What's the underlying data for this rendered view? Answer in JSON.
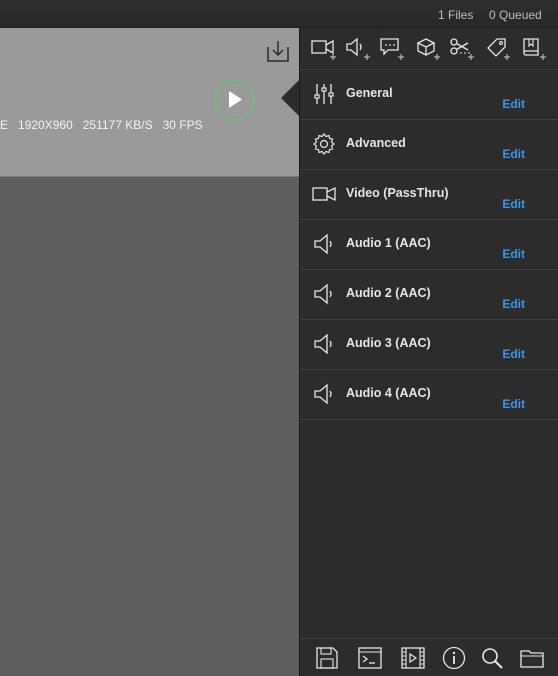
{
  "status": {
    "files": "1 Files",
    "queued": "0 Queued"
  },
  "file_item": {
    "info": [
      "E",
      "1920X960",
      "251177 KB/S",
      "30 FPS"
    ]
  },
  "toolbar": {
    "icons": [
      "add-video-icon",
      "add-audio-icon",
      "add-subtitle-icon",
      "add-package-icon",
      "add-trim-icon",
      "add-tag-icon",
      "add-chapter-icon"
    ]
  },
  "settings": {
    "items": [
      {
        "label": "General",
        "icon": "sliders-icon",
        "edit": "Edit"
      },
      {
        "label": "Advanced",
        "icon": "gear-icon",
        "edit": "Edit"
      },
      {
        "label": "Video (PassThru)",
        "icon": "video-camera-icon",
        "edit": "Edit"
      },
      {
        "label": "Audio 1 (AAC)",
        "icon": "speaker-icon",
        "edit": "Edit"
      },
      {
        "label": "Audio 2 (AAC)",
        "icon": "speaker-icon",
        "edit": "Edit"
      },
      {
        "label": "Audio 3 (AAC)",
        "icon": "speaker-icon",
        "edit": "Edit"
      },
      {
        "label": "Audio 4 (AAC)",
        "icon": "speaker-icon",
        "edit": "Edit"
      }
    ]
  },
  "bottom_bar": {
    "icons": [
      "save-icon",
      "terminal-icon",
      "film-icon",
      "info-icon",
      "search-icon",
      "folder-icon"
    ]
  },
  "colors": {
    "accent_edit": "#3b96e6",
    "play_ring": "#4fd46a",
    "panel_bg": "#2c2c2c"
  }
}
